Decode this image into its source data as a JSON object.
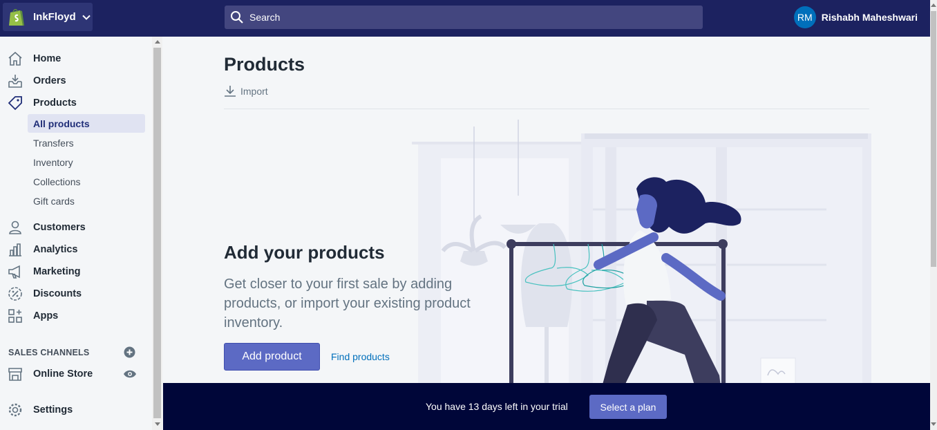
{
  "topbar": {
    "store_name": "InkFloyd",
    "search_placeholder": "Search",
    "user_initials": "RM",
    "user_name": "Rishabh Maheshwari"
  },
  "sidebar": {
    "items": [
      {
        "label": "Home",
        "icon": "home-icon"
      },
      {
        "label": "Orders",
        "icon": "orders-icon"
      },
      {
        "label": "Products",
        "icon": "tag-icon"
      },
      {
        "label": "Customers",
        "icon": "customer-icon"
      },
      {
        "label": "Analytics",
        "icon": "analytics-icon"
      },
      {
        "label": "Marketing",
        "icon": "megaphone-icon"
      },
      {
        "label": "Discounts",
        "icon": "discount-icon"
      },
      {
        "label": "Apps",
        "icon": "apps-icon"
      }
    ],
    "product_subitems": [
      "All products",
      "Transfers",
      "Inventory",
      "Collections",
      "Gift cards"
    ],
    "sales_channels_heading": "SALES CHANNELS",
    "online_store": "Online Store",
    "settings": "Settings"
  },
  "main": {
    "title": "Products",
    "import_label": "Import",
    "empty_title": "Add your products",
    "empty_description": "Get closer to your first sale by adding products, or import your existing product inventory.",
    "add_product_label": "Add product",
    "find_products_label": "Find products"
  },
  "trial_banner": {
    "message": "You have 13 days left in your trial",
    "select_plan_label": "Select a plan"
  },
  "colors": {
    "topbar": "#1c2260",
    "primary": "#5c6ac4",
    "banner": "#000639",
    "link": "#006fbb"
  }
}
